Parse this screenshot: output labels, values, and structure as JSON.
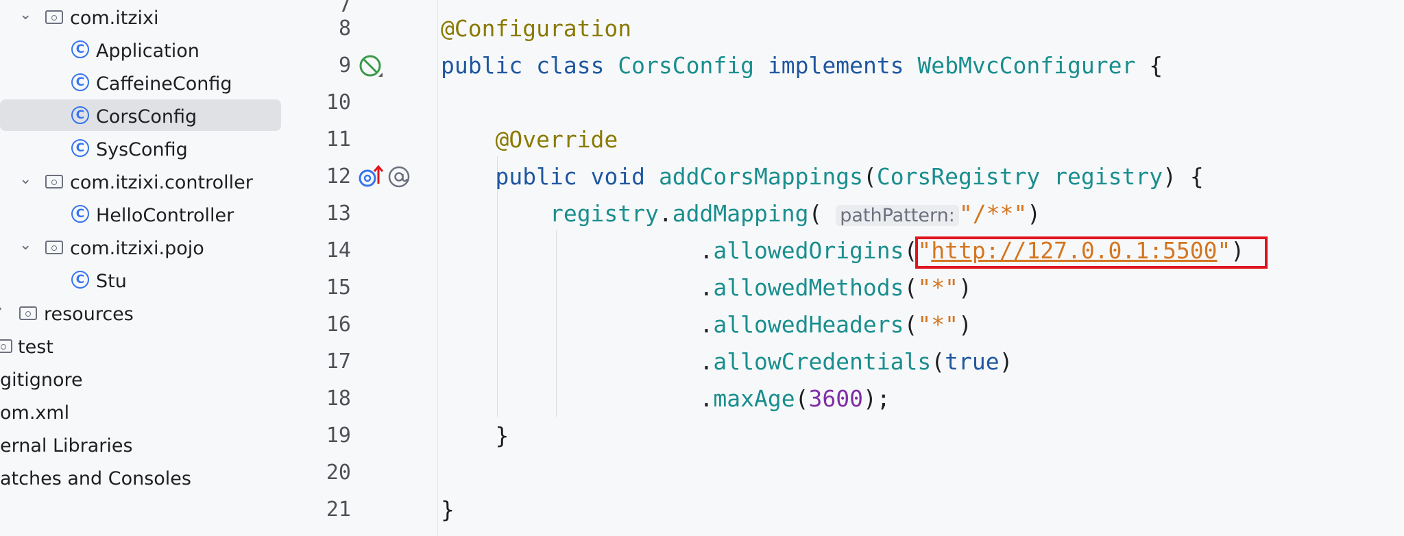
{
  "tree": [
    {
      "label": "com.itzixi",
      "kind": "package",
      "expanded": true
    },
    {
      "label": "Application",
      "kind": "class-run"
    },
    {
      "label": "CaffeineConfig",
      "kind": "class"
    },
    {
      "label": "CorsConfig",
      "kind": "class",
      "selected": true
    },
    {
      "label": "SysConfig",
      "kind": "class"
    },
    {
      "label": "com.itzixi.controller",
      "kind": "package",
      "expanded": true
    },
    {
      "label": "HelloController",
      "kind": "class"
    },
    {
      "label": "com.itzixi.pojo",
      "kind": "package",
      "expanded": true
    },
    {
      "label": "Stu",
      "kind": "class"
    },
    {
      "label": "resources",
      "kind": "resources-folder"
    },
    {
      "label": "test",
      "kind": "folder"
    },
    {
      "label": "gitignore",
      "kind": "file"
    },
    {
      "label": "om.xml",
      "kind": "file"
    },
    {
      "label": "ernal Libraries",
      "kind": "item"
    },
    {
      "label": "atches and Consoles",
      "kind": "item"
    }
  ],
  "gutter": {
    "lines": [
      "8",
      "9",
      "10",
      "11",
      "12",
      "13",
      "14",
      "15",
      "16",
      "17",
      "18",
      "19",
      "20",
      "21"
    ],
    "icons": {
      "line9": "no-bean-icon",
      "line12_a": "override-up-icon",
      "line12_b": "at-annotation-icon"
    }
  },
  "code": {
    "l8": {
      "annotation": "@Configuration"
    },
    "l9": {
      "kw1": "public",
      "kw2": "class",
      "cls": "CorsConfig",
      "kw3": "implements",
      "iface": "WebMvcConfigurer",
      "brace": "{"
    },
    "l11": {
      "annotation": "@Override"
    },
    "l12": {
      "kw1": "public",
      "kw2": "void",
      "method": "addCorsMappings",
      "open": "(",
      "ptype": "CorsRegistry",
      "pname": "registry",
      "close": ") {"
    },
    "l13": {
      "obj": "registry",
      "dot": ".",
      "method": "addMapping",
      "open": "(",
      "hint": "pathPattern:",
      "str": "\"/**\"",
      "close": ")"
    },
    "l14": {
      "dot": ".",
      "method": "allowedOrigins",
      "open": "(",
      "q1": "\"",
      "url": "http://127.0.0.1:5500",
      "q2": "\"",
      "close": ")"
    },
    "l15": {
      "dot": ".",
      "method": "allowedMethods",
      "open": "(",
      "str": "\"*\"",
      "close": ")"
    },
    "l16": {
      "dot": ".",
      "method": "allowedHeaders",
      "open": "(",
      "str": "\"*\"",
      "close": ")"
    },
    "l17": {
      "dot": ".",
      "method": "allowCredentials",
      "open": "(",
      "val": "true",
      "close": ")"
    },
    "l18": {
      "dot": ".",
      "method": "maxAge",
      "open": "(",
      "num": "3600",
      "close": ");"
    },
    "l19": {
      "brace": "}"
    },
    "l21": {
      "brace": "}"
    }
  },
  "highlight": {
    "color": "#e0141e",
    "target": "http://127.0.0.1:5500"
  }
}
